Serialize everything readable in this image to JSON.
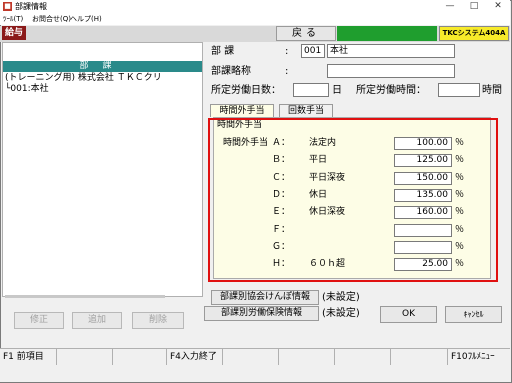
{
  "window": {
    "title": "部課情報",
    "minimize": "—",
    "maximize": "□",
    "close": "✕"
  },
  "menu": [
    "ﾂｰﾙ(T)",
    "お問合せ(Q)",
    "ヘルプ(H)"
  ],
  "toolbar": {
    "kyuyo": "給与",
    "back": "戻る",
    "logo": "TKCシステム404A",
    "brand_color": "#8b1a1a",
    "green_color": "#1f9e2e",
    "logo_color": "#f7ea2a"
  },
  "tree": {
    "header": "部課",
    "company": "(トレーニング用) 株式会社 ＴＫＣクリ",
    "node": "└001:本社"
  },
  "left_buttons": [
    "修正",
    "追加",
    "削除"
  ],
  "form": {
    "dept_label": "部 課",
    "dept_code": "001",
    "dept_name": "本社",
    "abbr_label": "部課略称",
    "abbr_value": "",
    "days_label": "所定労働日数：",
    "days_value": "",
    "days_unit": "日",
    "hours_label": "所定労働時間：",
    "hours_value": "",
    "hours_unit": "時間"
  },
  "tabs": [
    "時間外手当",
    "回数手当"
  ],
  "overtime": {
    "group_title": "時間外手当",
    "heading": "時間外手当",
    "rows": [
      {
        "letter": "Ａ：",
        "name": "法定内",
        "value": "100.00",
        "unit": "％"
      },
      {
        "letter": "Ｂ：",
        "name": "平日",
        "value": "125.00",
        "unit": "％"
      },
      {
        "letter": "Ｃ：",
        "name": "平日深夜",
        "value": "150.00",
        "unit": "％"
      },
      {
        "letter": "Ｄ：",
        "name": "休日",
        "value": "135.00",
        "unit": "％"
      },
      {
        "letter": "Ｅ：",
        "name": "休日深夜",
        "value": "160.00",
        "unit": "％"
      },
      {
        "letter": "Ｆ：",
        "name": "",
        "value": "",
        "unit": "％"
      },
      {
        "letter": "Ｇ：",
        "name": "",
        "value": "",
        "unit": "％"
      },
      {
        "letter": "Ｈ：",
        "name": "６０ｈ超",
        "value": "25.00",
        "unit": "％"
      }
    ]
  },
  "info_buttons": {
    "kenpo": "部課別協会けんぽ情報",
    "kenpo_status": "(未設定)",
    "rousai": "部課別労働保険情報",
    "rousai_status": "(未設定)"
  },
  "actions": {
    "ok": "OK",
    "cancel": "ｷｬﾝｾﾙ"
  },
  "fkeys": {
    "f1": "F1 前項目",
    "f4": "F4入力終了",
    "f10": "F10ﾌﾙﾒﾆｭｰ"
  }
}
